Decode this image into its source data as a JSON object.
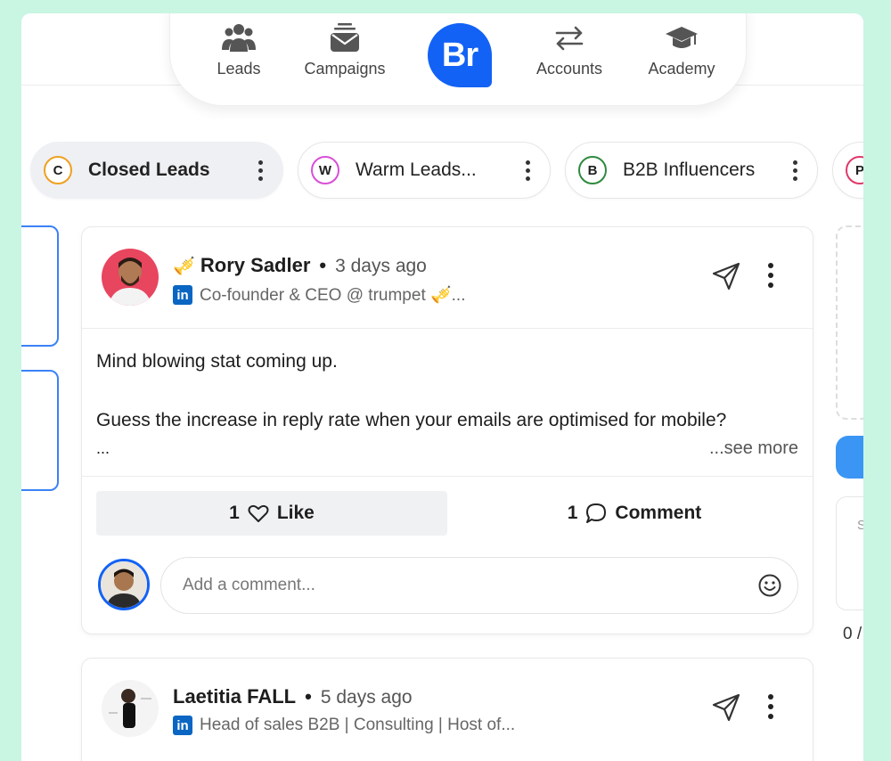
{
  "nav": {
    "items": [
      {
        "label": "Leads",
        "icon": "users-icon"
      },
      {
        "label": "Campaigns",
        "icon": "inbox-icon"
      },
      {
        "label": "Accounts",
        "icon": "swap-arrows-icon"
      },
      {
        "label": "Academy",
        "icon": "graduation-cap-icon"
      }
    ],
    "brand": "Br",
    "brand_color": "#1262f5"
  },
  "tabs": [
    {
      "badge": "C",
      "label": "Closed Leads",
      "color": "#f0a020"
    },
    {
      "badge": "W",
      "label": "Warm Leads...",
      "color": "#d84fd8"
    },
    {
      "badge": "B",
      "label": "B2B Influencers",
      "color": "#2e8a3e"
    },
    {
      "badge": "P",
      "label": "",
      "color": "#e0386a"
    }
  ],
  "posts": [
    {
      "emoji": "🎺",
      "author": "Rory Sadler",
      "time": "3 days ago",
      "headline": "Co-founder & CEO @ trumpet 🎺...",
      "body_line1": "Mind blowing stat coming up.",
      "body_line2": "Guess the increase in reply rate when your emails are optimised for mobile?",
      "ellipsis": "...",
      "see_more": "...see more",
      "likes": "1",
      "like_label": "Like",
      "comments": "1",
      "comment_label": "Comment",
      "comment_placeholder": "Add a comment..."
    },
    {
      "author": "Laetitia FALL",
      "time": "5 days ago",
      "headline": "Head of sales B2B | Consulting | Host of..."
    }
  ],
  "linkedin_badge": "in",
  "right_column": {
    "partial_letter": "S",
    "count": "0 /"
  }
}
